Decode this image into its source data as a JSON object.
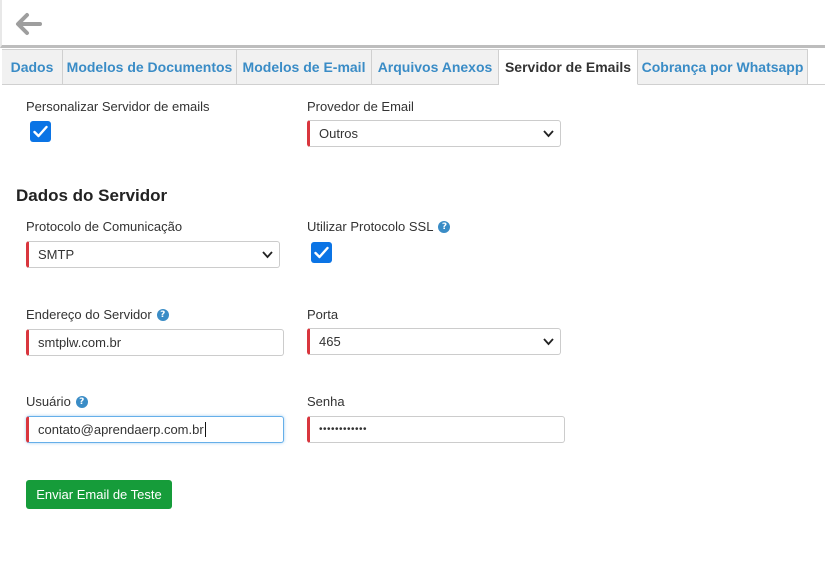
{
  "tabs": [
    {
      "label": "Dados"
    },
    {
      "label": "Modelos de Documentos"
    },
    {
      "label": "Modelos de E-mail"
    },
    {
      "label": "Arquivos Anexos"
    },
    {
      "label": "Servidor de Emails",
      "active": true
    },
    {
      "label": "Cobrança por Whatsapp"
    }
  ],
  "form": {
    "custom_server": {
      "label": "Personalizar Servidor de emails",
      "checked": true
    },
    "provider": {
      "label": "Provedor de Email",
      "value": "Outros"
    },
    "section_title": "Dados do Servidor",
    "protocol": {
      "label": "Protocolo de Comunicação",
      "value": "SMTP"
    },
    "ssl": {
      "label": "Utilizar Protocolo SSL",
      "checked": true
    },
    "server_address": {
      "label": "Endereço do Servidor",
      "value": "smtplw.com.br"
    },
    "port": {
      "label": "Porta",
      "value": "465"
    },
    "user": {
      "label": "Usuário",
      "value": "contato@aprendaerp.com.br"
    },
    "password": {
      "label": "Senha",
      "value": "••••••••••••"
    },
    "test_button": "Enviar Email de Teste"
  },
  "icons": {
    "back": "arrow-left-icon",
    "help": "question-circle-icon",
    "check": "checkmark-icon",
    "dropdown": "chevron-down-icon"
  },
  "colors": {
    "accent": "#3a8cc6",
    "required_border": "#d9363e",
    "checkbox": "#0b74e5",
    "primary_button": "#169c3a"
  }
}
